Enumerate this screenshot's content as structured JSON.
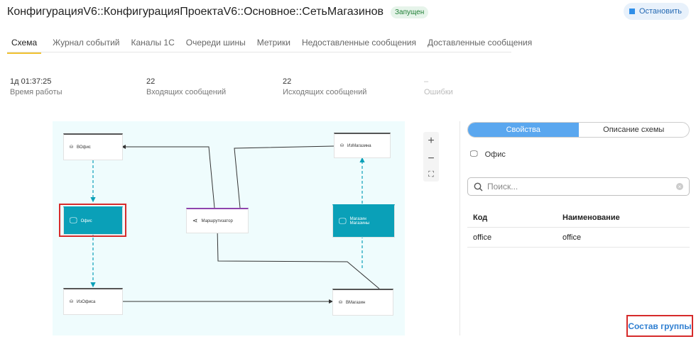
{
  "header": {
    "title": "КонфигурацияV6::КонфигурацияПроектаV6::Основное::СетьМагазинов",
    "status_badge": "Запущен",
    "stop_label": "Остановить"
  },
  "tabs": [
    {
      "label": "Схема",
      "active": true
    },
    {
      "label": "Журнал событий"
    },
    {
      "label": "Каналы 1С"
    },
    {
      "label": "Очереди шины"
    },
    {
      "label": "Метрики"
    },
    {
      "label": "Недоставленные сообщения"
    },
    {
      "label": "Доставленные сообщения"
    }
  ],
  "stats": [
    {
      "value": "1д 01:37:25",
      "label": "Время работы"
    },
    {
      "value": "22",
      "label": "Входящих сообщений"
    },
    {
      "value": "22",
      "label": "Исходящих сообщений"
    },
    {
      "value": "–",
      "label": "Ошибки"
    }
  ],
  "diagram": {
    "nodes": {
      "vofis": "ВОфис",
      "ofis": "Офис",
      "izofisa": "ИзОфиса",
      "router": "Маршрутизатор",
      "izmagazina": "ИзМагазина",
      "magaziny_1": "Магазин",
      "magaziny_2": "Магазины",
      "vmagazin": "ВМагазин"
    }
  },
  "zoom": {
    "plus": "+",
    "minus": "−",
    "fit": "⛶"
  },
  "panel": {
    "tab_properties": "Свойства",
    "tab_description": "Описание схемы",
    "selected_title": "Офис",
    "search_placeholder": "Поиск...",
    "table": {
      "col_code": "Код",
      "col_name": "Наименование",
      "rows": [
        {
          "code": "office",
          "name": "office"
        }
      ]
    },
    "group_button": "Состав группы"
  },
  "colors": {
    "accent": "#0aa0b8",
    "selection": "#d62b2b",
    "active_tab": "#5aa7ef",
    "tab_underline": "#f1c232"
  }
}
